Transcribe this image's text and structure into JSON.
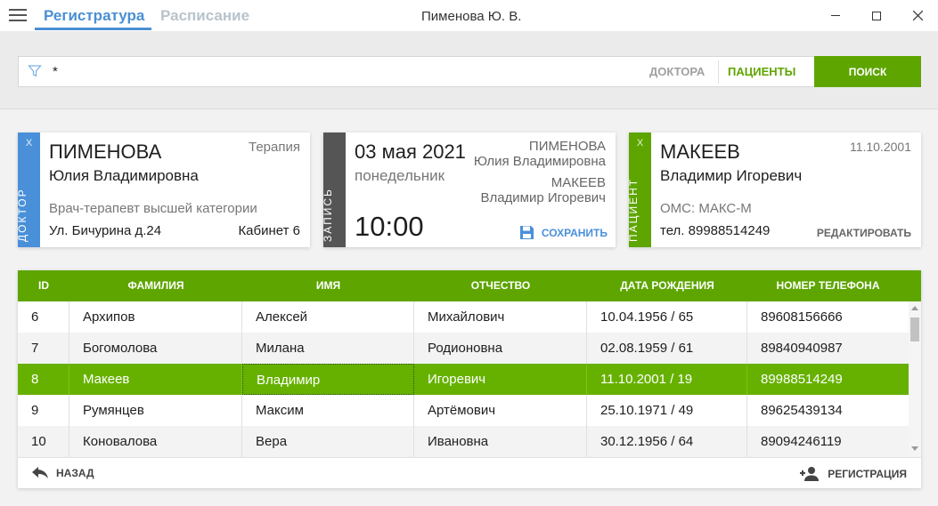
{
  "colors": {
    "accent_blue": "#4a90d9",
    "accent_green": "#5ea500",
    "selected_row": "#66b100",
    "dark_strip": "#555555"
  },
  "titlebar": {
    "tabs": [
      {
        "label": "Регистратура",
        "active": true
      },
      {
        "label": "Расписание",
        "active": false
      }
    ],
    "window_title": "Пименова Ю. В."
  },
  "search": {
    "value": "*",
    "segments": {
      "doctors": "ДОКТОРА",
      "patients": "ПАЦИЕНТЫ",
      "active": "patients"
    },
    "button_label": "ПОИСК"
  },
  "doctor_card": {
    "strip_close": "X",
    "strip_label": "ДОКТОР",
    "surname": "ПИМЕНОВА",
    "name": "Юлия Владимировна",
    "specialty": "Терапия",
    "position": "Врач-терапевт высшей категории",
    "address": "Ул. Бичурина д.24",
    "room": "Кабинет 6"
  },
  "appointment_card": {
    "strip_label": "ЗАПИСЬ",
    "date": "03 мая 2021",
    "weekday": "понедельник",
    "time": "10:00",
    "doctor_surname": "ПИМЕНОВА",
    "doctor_name": "Юлия Владимировна",
    "patient_surname": "МАКЕЕВ",
    "patient_name": "Владимир Игоревич",
    "save_label": "СОХРАНИТЬ"
  },
  "patient_card": {
    "strip_close": "X",
    "strip_label": "ПАЦИЕНТ",
    "surname": "МАКЕЕВ",
    "name": "Владимир Игоревич",
    "birthdate": "11.10.2001",
    "insurance": "ОМС: МАКС-М",
    "phone": "тел. 89988514249",
    "edit_label": "РЕДАКТИРОВАТЬ"
  },
  "table": {
    "columns": [
      "ID",
      "ФАМИЛИЯ",
      "ИМЯ",
      "ОТЧЕСТВО",
      "ДАТА РОЖДЕНИЯ",
      "НОМЕР ТЕЛЕФОНА"
    ],
    "rows": [
      [
        "6",
        "Архипов",
        "Алексей",
        "Михайлович",
        "10.04.1956 / 65",
        "89608156666"
      ],
      [
        "7",
        "Богомолова",
        "Милана",
        "Родионовна",
        "02.08.1959 / 61",
        "89840940987"
      ],
      [
        "8",
        "Макеев",
        "Владимир",
        "Игоревич",
        "11.10.2001 / 19",
        "89988514249"
      ],
      [
        "9",
        "Румянцев",
        "Максим",
        "Артёмович",
        "25.10.1971 / 49",
        "89625439134"
      ],
      [
        "10",
        "Коновалова",
        "Вера",
        "Ивановна",
        "30.12.1956 / 64",
        "89094246119"
      ]
    ],
    "selected_row": 2,
    "back_label": "НАЗАД",
    "register_label": "РЕГИСТРАЦИЯ"
  }
}
